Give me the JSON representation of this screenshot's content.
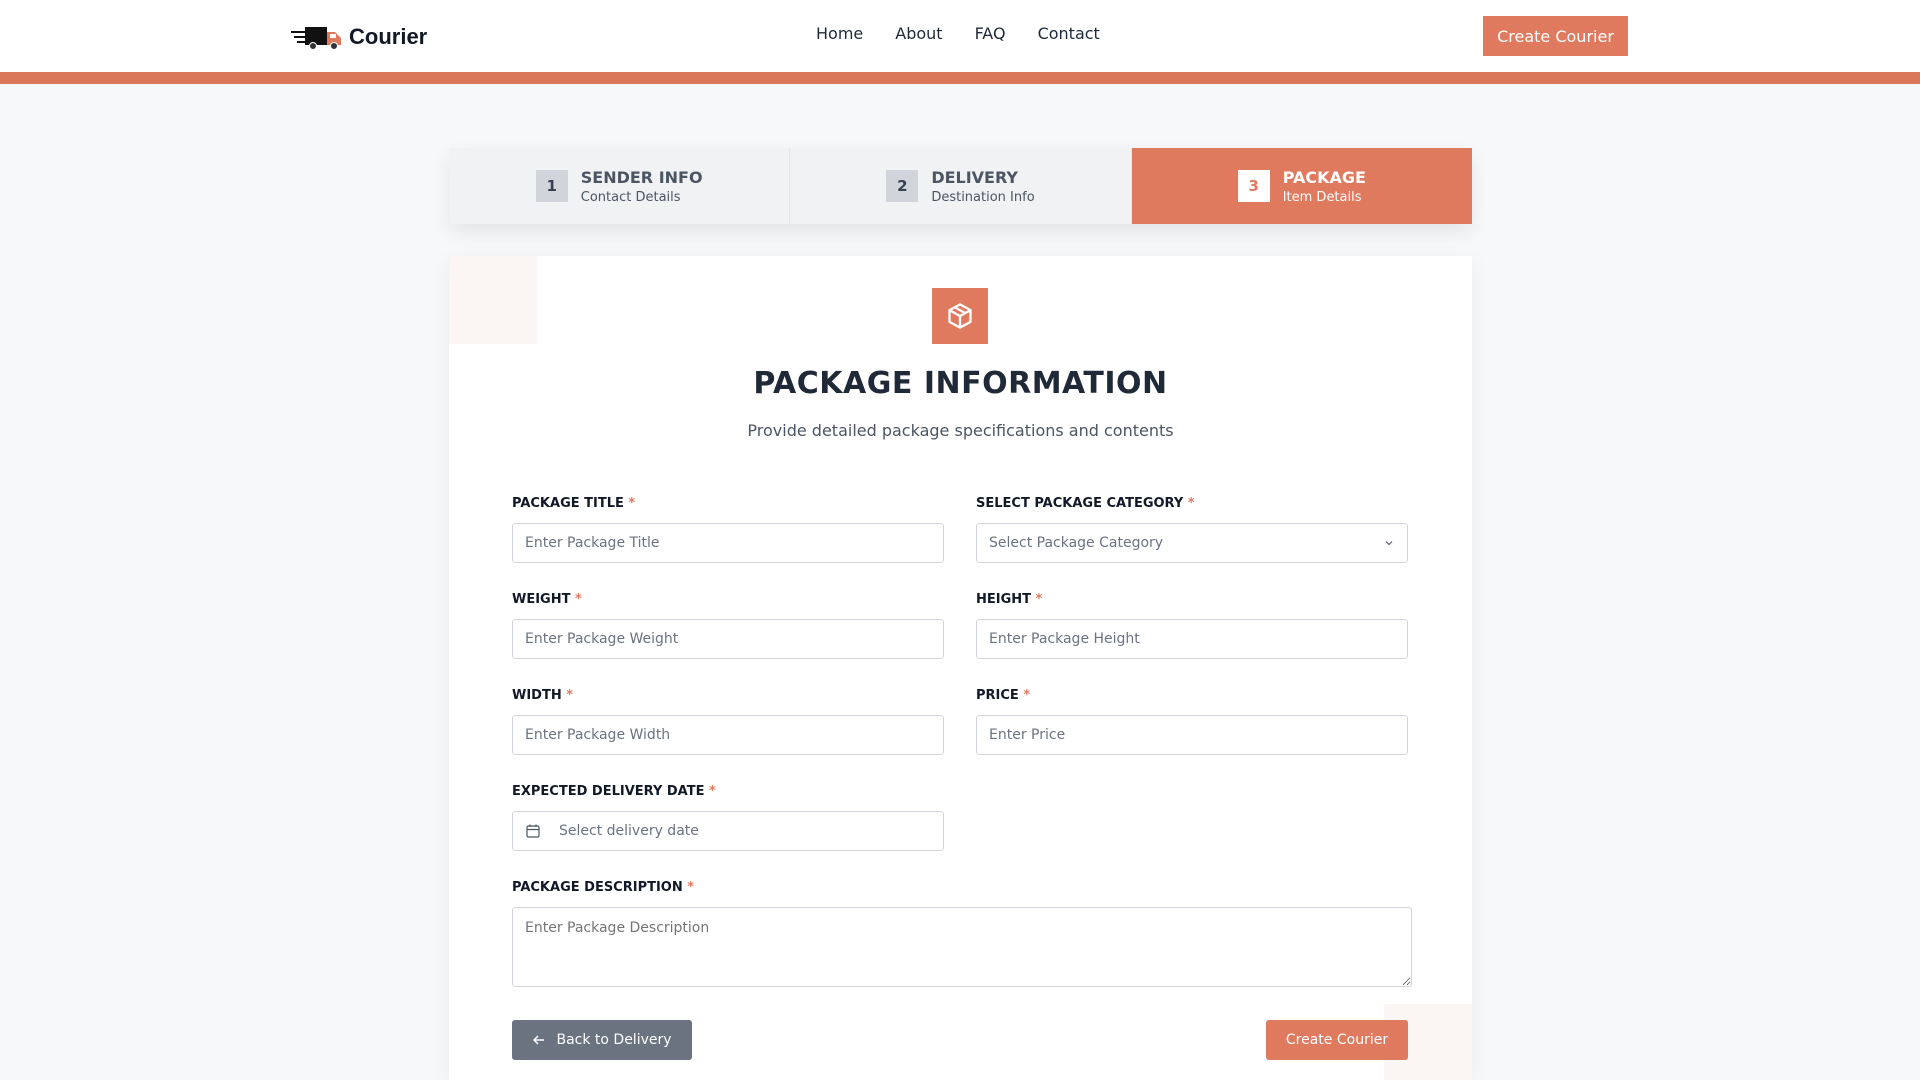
{
  "header": {
    "logo_text": "Courier",
    "nav": [
      "Home",
      "About",
      "FAQ",
      "Contact"
    ],
    "cta_label": "Create Courier"
  },
  "colors": {
    "accent": "#e07a5f",
    "bar": "#d9785a",
    "back_button": "#6b7280"
  },
  "stepper": [
    {
      "number": "1",
      "title": "SENDER INFO",
      "subtitle": "Contact Details",
      "active": false
    },
    {
      "number": "2",
      "title": "DELIVERY",
      "subtitle": "Destination Info",
      "active": false
    },
    {
      "number": "3",
      "title": "PACKAGE",
      "subtitle": "Item Details",
      "active": true
    }
  ],
  "card": {
    "icon": "package-icon",
    "title": "PACKAGE INFORMATION",
    "subtitle": "Provide detailed package specifications and contents"
  },
  "form": {
    "title": {
      "label": "PACKAGE TITLE",
      "placeholder": "Enter Package Title"
    },
    "category": {
      "label": "SELECT PACKAGE CATEGORY",
      "placeholder": "Select Package Category"
    },
    "weight": {
      "label": "WEIGHT",
      "placeholder": "Enter Package Weight"
    },
    "height": {
      "label": "HEIGHT",
      "placeholder": "Enter Package Height"
    },
    "width": {
      "label": "WIDTH",
      "placeholder": "Enter Package Width"
    },
    "price": {
      "label": "PRICE",
      "placeholder": "Enter Price"
    },
    "date": {
      "label": "EXPECTED DELIVERY DATE",
      "placeholder": "Select delivery date"
    },
    "description": {
      "label": "PACKAGE DESCRIPTION",
      "placeholder": "Enter Package Description"
    },
    "required_mark": "*"
  },
  "buttons": {
    "back": "Back to Delivery",
    "create": "Create Courier"
  }
}
